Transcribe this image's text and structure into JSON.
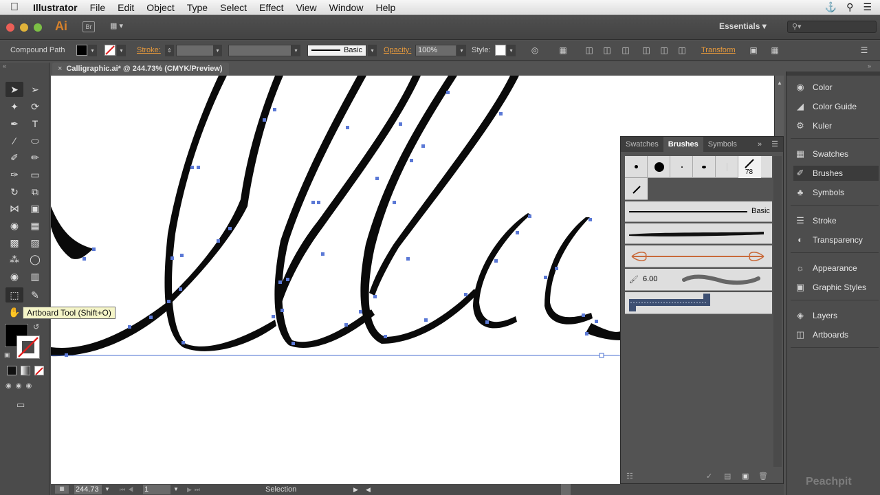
{
  "menubar": {
    "app": "Illustrator",
    "items": [
      "File",
      "Edit",
      "Object",
      "Type",
      "Select",
      "Effect",
      "View",
      "Window",
      "Help"
    ]
  },
  "appbar": {
    "logo": "Ai",
    "bridge": "Br",
    "workspace": "Essentials"
  },
  "control": {
    "selection_type": "Compound Path",
    "stroke_label": "Stroke:",
    "brush_name": "Basic",
    "opacity_label": "Opacity:",
    "opacity_value": "100%",
    "style_label": "Style:",
    "transform_label": "Transform"
  },
  "document": {
    "tab_title": "Calligraphic.ai* @ 244.73% (CMYK/Preview)"
  },
  "tooltip": "Artboard Tool (Shift+O)",
  "brushes_panel": {
    "tabs": [
      "Swatches",
      "Brushes",
      "Symbols"
    ],
    "size_badge": "78",
    "basic_label": "Basic",
    "size_value": "6.00"
  },
  "dock": {
    "items": [
      "Color",
      "Color Guide",
      "Kuler",
      "Swatches",
      "Brushes",
      "Symbols",
      "Stroke",
      "Transparency",
      "Appearance",
      "Graphic Styles",
      "Layers",
      "Artboards"
    ],
    "active": "Brushes"
  },
  "status": {
    "zoom": "244.73",
    "artboard": "1",
    "mode": "Selection"
  },
  "watermark": "Peachpit"
}
